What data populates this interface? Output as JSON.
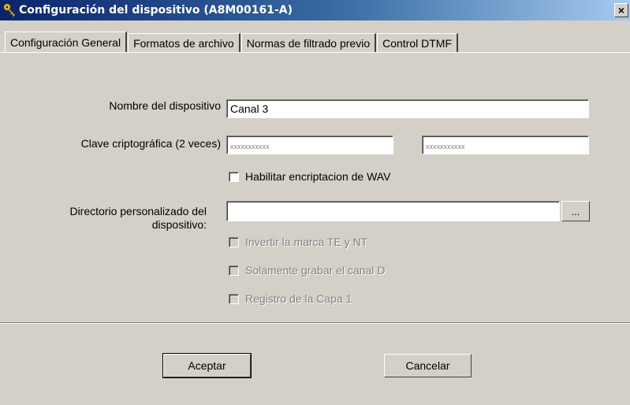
{
  "window": {
    "title": "Configuración del dispositivo (A8M00161-A)",
    "close_label": "×"
  },
  "tabs": [
    {
      "label": "Configuración General",
      "active": true
    },
    {
      "label": "Formatos de archivo",
      "active": false
    },
    {
      "label": "Normas de filtrado previo",
      "active": false
    },
    {
      "label": "Control DTMF",
      "active": false
    }
  ],
  "general": {
    "device_name_label": "Nombre del dispositivo",
    "device_name_value": "Canal 3",
    "crypto_key_label": "Clave criptográfica (2 veces)",
    "crypto_key_1_value": "xxxxxxxxxxx",
    "crypto_key_2_value": "xxxxxxxxxxx",
    "wav_encryption_label": "Habilitar encriptacion de WAV",
    "custom_dir_label_line1": "Directorio personalizado del",
    "custom_dir_label_line2": "dispositivo:",
    "custom_dir_value": "",
    "browse_label": "...",
    "invert_te_nt_label": "Invertir la marca TE y NT",
    "record_d_channel_label": "Solamente grabar el canal D",
    "layer1_log_label": "Registro de la Capa 1"
  },
  "buttons": {
    "accept_label": "Aceptar",
    "cancel_label": "Cancelar"
  },
  "colors": {
    "dialog_bg": "#d4d0c8",
    "titlebar_start": "#0a246a",
    "titlebar_end": "#a6caf0",
    "disabled_text": "#808080"
  }
}
